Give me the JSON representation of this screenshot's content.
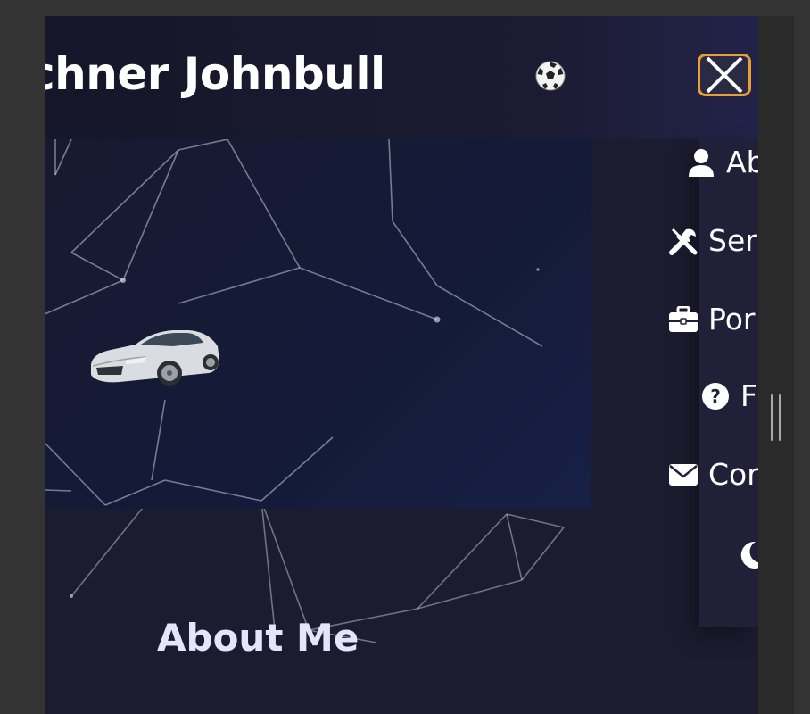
{
  "header": {
    "brand_title": "chner Johnbull",
    "ball_icon": "soccer-ball-icon",
    "close_icon": "close-icon",
    "close_border_color": "#e8a032"
  },
  "nav": {
    "items": [
      {
        "label": "Ab",
        "icon": "user-icon"
      },
      {
        "label": "Ser",
        "icon": "tools-icon"
      },
      {
        "label": "Por",
        "icon": "briefcase-icon"
      },
      {
        "label": "F",
        "icon": "question-circle-icon"
      },
      {
        "label": "Cor",
        "icon": "envelope-icon"
      }
    ],
    "theme_toggle_icon": "moon-icon"
  },
  "main": {
    "about_title": "About Me",
    "hero_image": "car-image"
  },
  "colors": {
    "page_background": "#1c1c30",
    "accent": "#e8a032",
    "heading": "#e4e4fb"
  }
}
